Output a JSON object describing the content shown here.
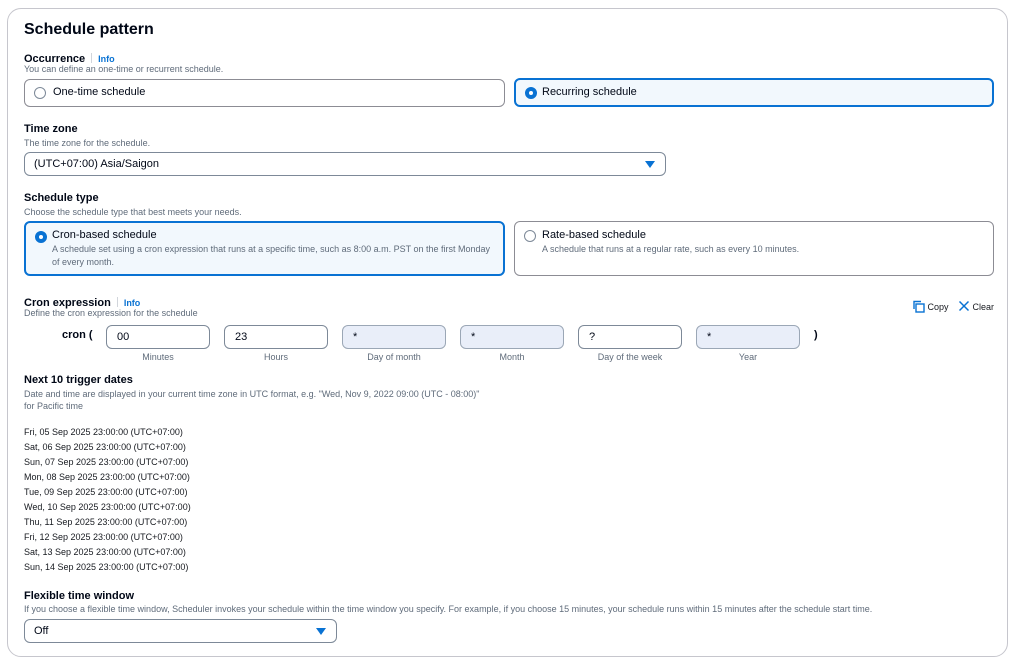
{
  "section": {
    "title": "Schedule pattern"
  },
  "occurrence": {
    "label": "Occurrence",
    "info": "Info",
    "description": "You can define an one-time or recurrent schedule.",
    "options": [
      {
        "label": "One-time schedule",
        "selected": false
      },
      {
        "label": "Recurring schedule",
        "selected": true
      }
    ]
  },
  "timezone": {
    "label": "Time zone",
    "description": "The time zone for the schedule.",
    "value": "(UTC+07:00) Asia/Saigon"
  },
  "schedule_type": {
    "label": "Schedule type",
    "description": "Choose the schedule type that best meets your needs.",
    "options": [
      {
        "title": "Cron-based schedule",
        "desc": "A schedule set using a cron expression that runs at a specific time, such as 8:00 a.m. PST on the first Monday of every month.",
        "selected": true
      },
      {
        "title": "Rate-based schedule",
        "desc": "A schedule that runs at a regular rate, such as every 10 minutes.",
        "selected": false
      }
    ]
  },
  "cron": {
    "label": "Cron expression",
    "info": "Info",
    "description": "Define the cron expression for the schedule",
    "copy": "Copy",
    "clear": "Clear",
    "prefix": "cron (",
    "suffix": ")",
    "fields": [
      {
        "value": "00",
        "caption": "Minutes",
        "editable": true
      },
      {
        "value": "23",
        "caption": "Hours",
        "editable": true
      },
      {
        "value": "*",
        "caption": "Day of month",
        "editable": false
      },
      {
        "value": "*",
        "caption": "Month",
        "editable": false
      },
      {
        "value": "?",
        "caption": "Day of the week",
        "editable": true
      },
      {
        "value": "*",
        "caption": "Year",
        "editable": false
      }
    ]
  },
  "trigger": {
    "label": "Next 10 trigger dates",
    "desc_line1": "Date and time are displayed in your current time zone in UTC format, e.g. \"Wed, Nov 9, 2022 09:00 (UTC - 08:00)\"",
    "desc_line2": "for Pacific time",
    "dates": [
      "Fri, 05 Sep 2025 23:00:00 (UTC+07:00)",
      "Sat, 06 Sep 2025 23:00:00 (UTC+07:00)",
      "Sun, 07 Sep 2025 23:00:00 (UTC+07:00)",
      "Mon, 08 Sep 2025 23:00:00 (UTC+07:00)",
      "Tue, 09 Sep 2025 23:00:00 (UTC+07:00)",
      "Wed, 10 Sep 2025 23:00:00 (UTC+07:00)",
      "Thu, 11 Sep 2025 23:00:00 (UTC+07:00)",
      "Fri, 12 Sep 2025 23:00:00 (UTC+07:00)",
      "Sat, 13 Sep 2025 23:00:00 (UTC+07:00)",
      "Sun, 14 Sep 2025 23:00:00 (UTC+07:00)"
    ]
  },
  "flex": {
    "label": "Flexible time window",
    "description": "If you choose a flexible time window, Scheduler invokes your schedule within the time window you specify. For example, if you choose 15 minutes, your schedule runs within 15 minutes after the schedule start time.",
    "value": "Off"
  },
  "colors": {
    "accent": "#0972d3",
    "selected_bg": "#f2f8fd",
    "disabled_field_bg": "#e9eef9"
  },
  "icons": {
    "copy": "copy-icon",
    "clear": "close-icon",
    "select": "caret-down-icon"
  }
}
